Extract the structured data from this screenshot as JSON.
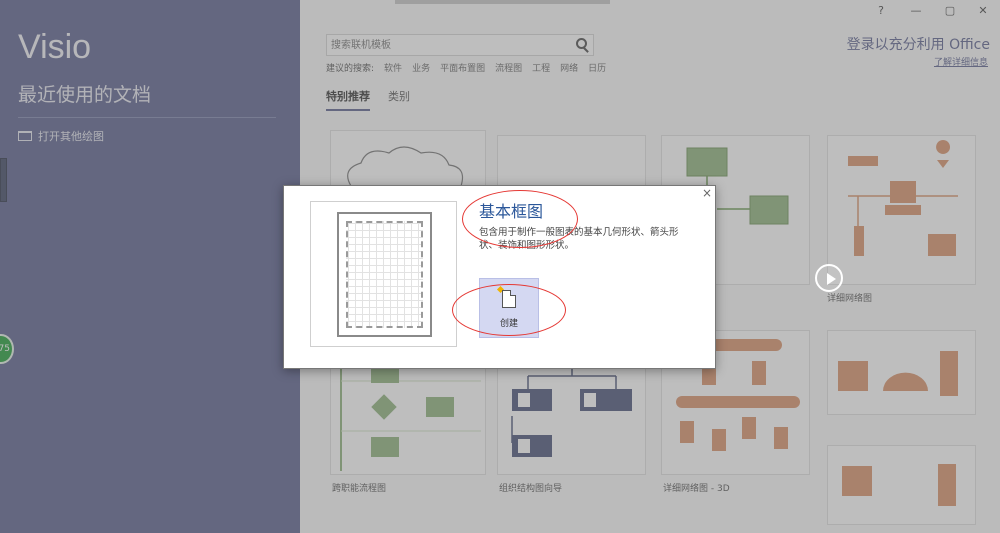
{
  "sidebar": {
    "app_name": "Visio",
    "recent_heading": "最近使用的文档",
    "open_other": "打开其他绘图"
  },
  "badge": {
    "text": "75"
  },
  "window": {
    "help": "?",
    "minimize": "—",
    "restore": "▢",
    "close": "✕"
  },
  "search": {
    "placeholder": "搜索联机模板"
  },
  "suggested": {
    "label": "建议的搜索:",
    "items": [
      "软件",
      "业务",
      "平面布置图",
      "流程图",
      "工程",
      "网络",
      "日历"
    ]
  },
  "tabs": [
    {
      "label": "特别推荐",
      "active": true
    },
    {
      "label": "类别",
      "active": false
    }
  ],
  "account": {
    "signin": "登录以充分利用 Office",
    "learn_more": "了解详细信息"
  },
  "templates": [
    {
      "label": ""
    },
    {
      "label": ""
    },
    {
      "label": ""
    },
    {
      "label": "详细网络图"
    },
    {
      "label": ""
    },
    {
      "label": "跨职能流程图"
    },
    {
      "label": "组织结构图向导"
    },
    {
      "label": "详细网络图 - 3D"
    },
    {
      "label": ""
    },
    {
      "label": ""
    }
  ],
  "dialog": {
    "title": "基本框图",
    "description": "包含用于制作一般图表的基本几何形状、箭头形状、装饰和图形形状。",
    "create_label": "创建",
    "close": "×"
  },
  "colors": {
    "sidebar": "#5b628f",
    "accent": "#2b579a",
    "create_button": "#d4d8f2",
    "annotation": "#e53935",
    "diagram_green": "#8fb27c",
    "diagram_orange": "#d9936b",
    "diagram_navy": "#4a5379"
  }
}
